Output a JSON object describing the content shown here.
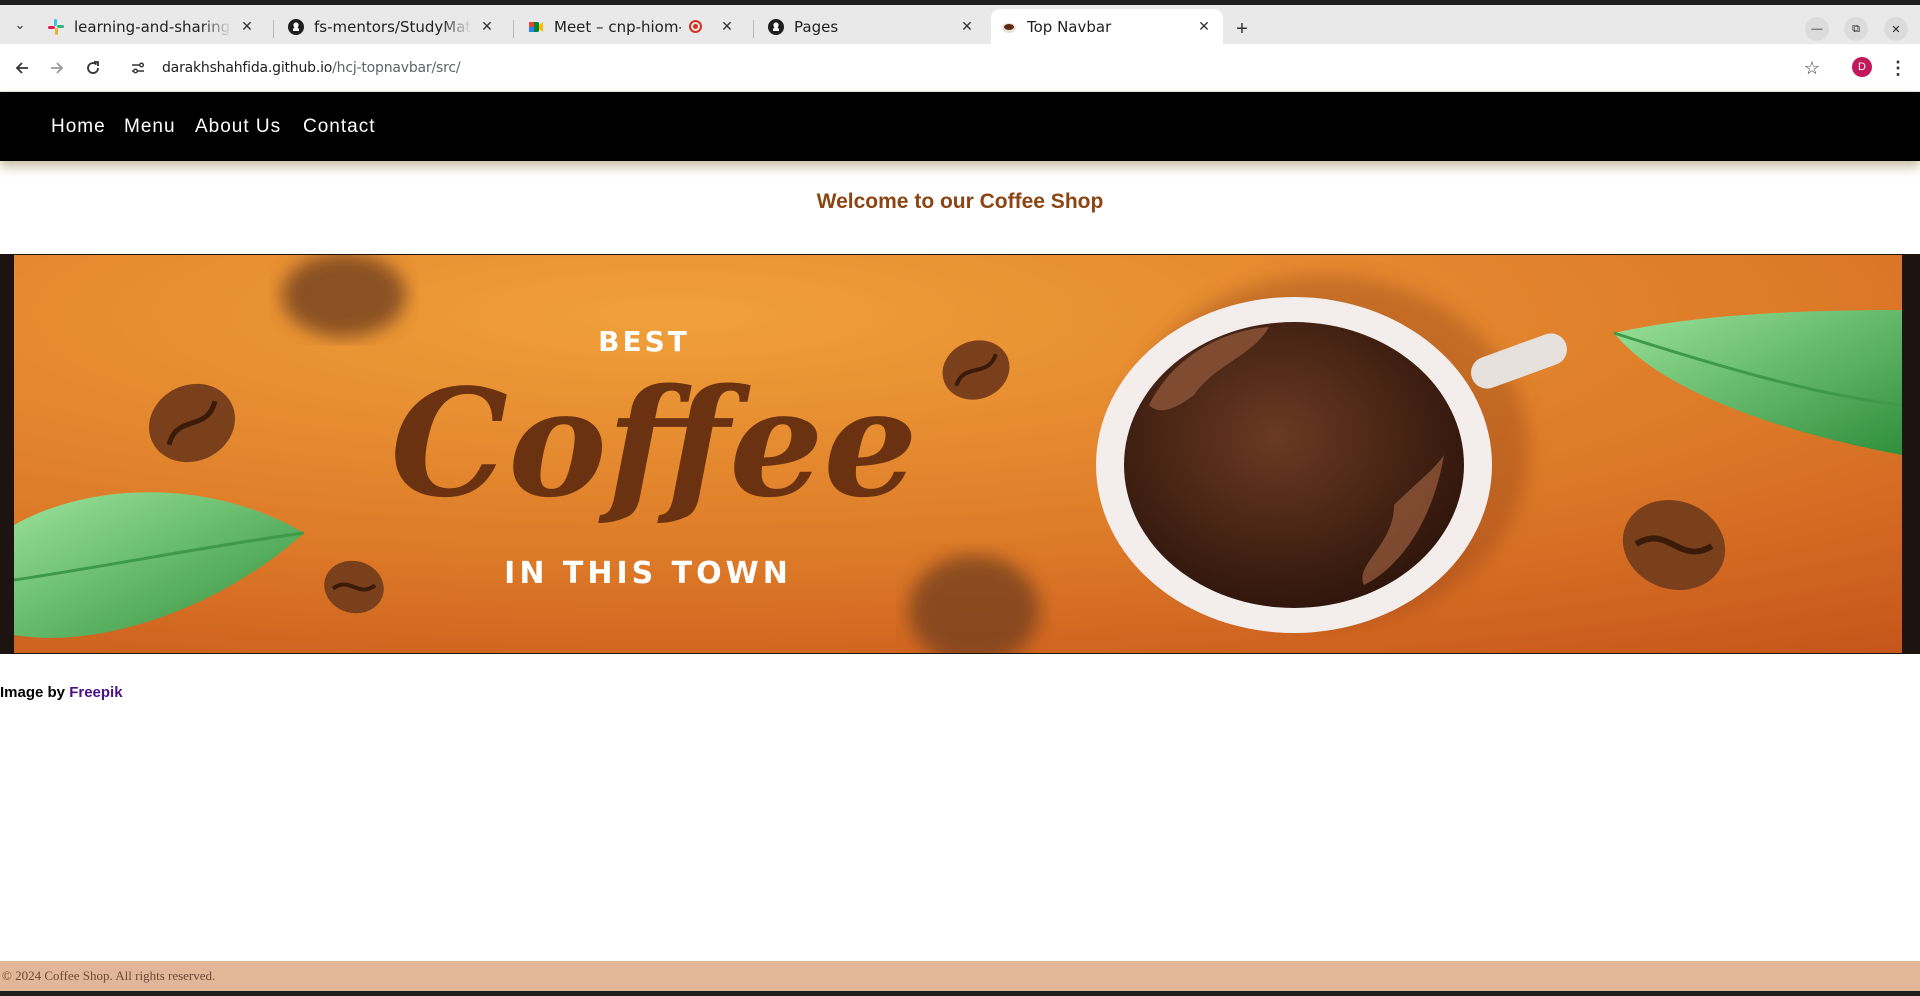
{
  "browser": {
    "tabs": [
      {
        "title": "learning-and-sharing (Ch",
        "icon": "slack-icon"
      },
      {
        "title": "fs-mentors/StudyMateri",
        "icon": "github-icon"
      },
      {
        "title": "Meet – cnp-hiom-khx",
        "icon": "google-meet-icon",
        "recording": true
      },
      {
        "title": "Pages",
        "icon": "github-icon"
      },
      {
        "title": "Top Navbar",
        "icon": "coffee-cup-icon",
        "active": true
      }
    ],
    "url_host": "darakhshahfida.github.io",
    "url_path": "/hcj-topnavbar/src/",
    "profile_initial": "D"
  },
  "page": {
    "nav": {
      "items": [
        "Home",
        "Menu",
        "About Us",
        "Contact"
      ]
    },
    "welcome": "Welcome to our Coffee Shop",
    "hero": {
      "line1": "BEST",
      "line2": "Coffee",
      "line3": "IN THIS TOWN"
    },
    "credit": {
      "prefix": "Image by",
      "link": "Freepik"
    },
    "footer": "© 2024 Coffee Shop. All rights reserved."
  },
  "colors": {
    "nav_bg": "#000000",
    "welcome_text": "#8b4513",
    "hero_orange": "#e4892f",
    "footer_bg": "#e2b799",
    "credit_link": "#4b0f8a"
  }
}
